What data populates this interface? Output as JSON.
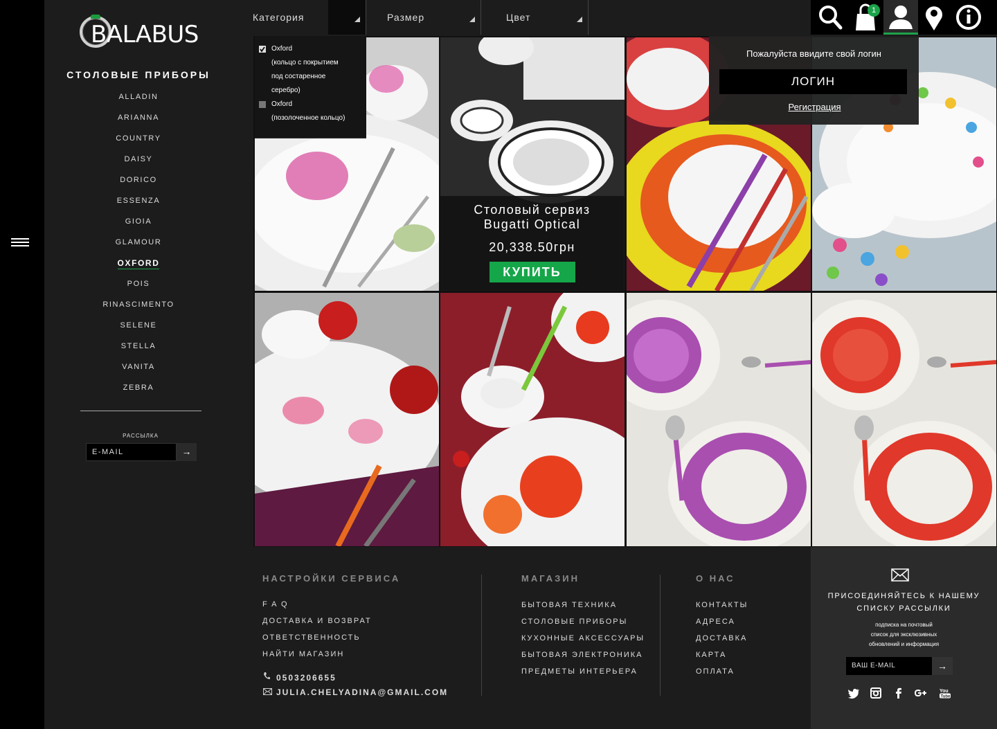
{
  "brand": {
    "logo_text": "BALABUS"
  },
  "sidebar": {
    "title": "СТОЛОВЫЕ ПРИБОРЫ",
    "items": [
      "ALLADIN",
      "ARIANNA",
      "COUNTRY",
      "DAISY",
      "DORICO",
      "ESSENZA",
      "GIOIA",
      "GLAMOUR",
      "OXFORD",
      "POIS",
      "RINASCIMENTO",
      "SELENE",
      "STELLA",
      "VANITA",
      "ZEBRA"
    ],
    "active_item": "OXFORD",
    "newsletter_label": "РАССЫЛКА",
    "newsletter_placeholder": "E-MAIL",
    "newsletter_button": "→"
  },
  "filters": {
    "category": "Категория",
    "size": "Размер",
    "color": "Цвет"
  },
  "category_dropdown": {
    "options": [
      {
        "label_lines": [
          "Oxford",
          "(кольцо с покрытием",
          "под состаренное",
          "серебро)"
        ],
        "checked": true
      },
      {
        "label_lines": [
          "Oxford",
          "(позолоченное кольцо)"
        ],
        "checked": false
      }
    ]
  },
  "topbar": {
    "icons": [
      "search-icon",
      "cart-icon",
      "user-icon",
      "location-icon",
      "info-icon"
    ],
    "cart_count": "1",
    "active_icon": "user-icon"
  },
  "login": {
    "prompt": "Пожалуйста ввидите свой логин",
    "button": "ЛОГИН",
    "register": "Регистрация"
  },
  "product": {
    "name_line1": "Столовый сервиз",
    "name_line2": "Bugatti Optical",
    "price": "20,338.50грн",
    "buy": "КУПИТЬ"
  },
  "footer": {
    "service": {
      "title": "НАСТРОЙКИ СЕРВИСА",
      "links": [
        "F A Q",
        "ДОСТАВКА И ВОЗВРАТ",
        "ОТВЕТСТВЕННОСТЬ",
        "НАЙТИ МАГАЗИН"
      ],
      "phone": "0503206655",
      "email": "JULIA.CHELYADINA@GMAIL.COM"
    },
    "shop": {
      "title": "МАГАЗИН",
      "links": [
        "БЫТОВАЯ ТЕХНИКА",
        "СТОЛОВЫЕ ПРИБОРЫ",
        "КУХОННЫЕ АКСЕССУАРЫ",
        "БЫТОВАЯ ЭЛЕКТРОНИКА",
        "ПРЕДМЕТЫ ИНТЕРЬЕРА"
      ]
    },
    "about": {
      "title": "О НАС",
      "links": [
        "КОНТАКТЫ",
        "АДРЕСА",
        "ДОСТАВКА",
        "КАРТА",
        "ОПЛАТА"
      ]
    }
  },
  "subscribe": {
    "title_line1": "ПРИСОЕДИНЯЙТЕСЬ К НАШЕМУ",
    "title_line2": "СПИСКУ РАССЫЛКИ",
    "text_line1": "подписка на почтовый",
    "text_line2": "список для эксклюзивных",
    "text_line3": "обновлений и информация",
    "placeholder": "ВАШ E-MAIL",
    "button": "→",
    "social": [
      "twitter-icon",
      "instagram-icon",
      "facebook-icon",
      "google-plus-icon",
      "youtube-icon"
    ]
  },
  "colors": {
    "accent": "#16a64a",
    "background": "#1c1c1c",
    "rail": "#000000"
  }
}
